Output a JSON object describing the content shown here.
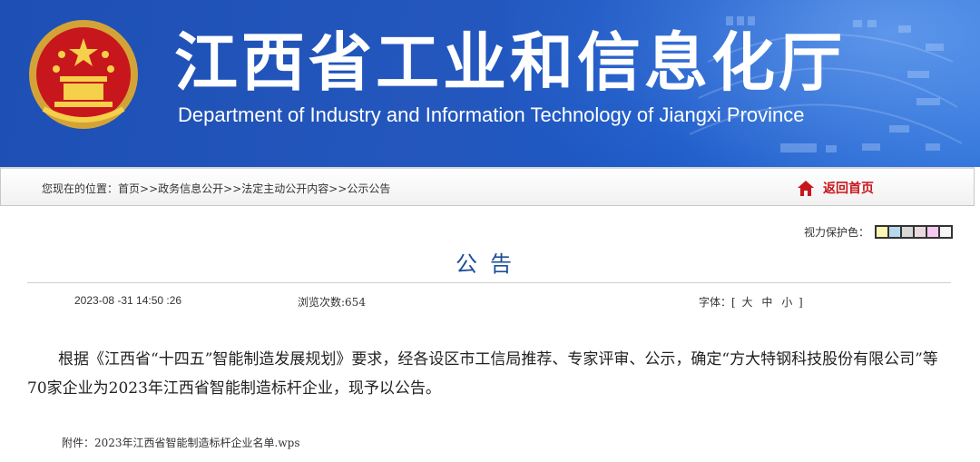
{
  "header": {
    "title": "江西省工业和信息化厅",
    "subtitle": "Department of Industry and Information Technology of Jiangxi Province"
  },
  "location": {
    "prefix": "您现在的位置：",
    "crumbs": [
      "首页",
      "政务信息公开",
      "法定主动公开内容",
      "公示公告"
    ],
    "separator": ">>",
    "home_label": "返回首页"
  },
  "eye_protection": {
    "label": "视力保护色：",
    "colors": [
      "#fbf7b2",
      "#b7d9ee",
      "#d8d8d8",
      "#eadadf",
      "#f4c8f0",
      "#f5f5f5"
    ]
  },
  "article": {
    "title": "公告",
    "date": "2023-08 -31 14:50 :26",
    "views_label": "浏览次数:",
    "views": "654",
    "font_label": "字体：[",
    "font_sizes": [
      "大",
      "中",
      "小"
    ],
    "font_close": "]",
    "body": "根据《江西省“十四五”智能制造发展规划》要求，经各设区市工信局推荐、专家评审、公示，确定“方大特钢科技股份有限公司”等70家企业为2023年江西省智能制造标杆企业，现予以公告。",
    "attachment_label": "附件：",
    "attachment_file": "2023年江西省智能制造标杆企业名单.wps"
  },
  "colors": {
    "banner": "#1d4fb4",
    "title_blue": "#1f4e98",
    "home_red": "#c8161d"
  }
}
